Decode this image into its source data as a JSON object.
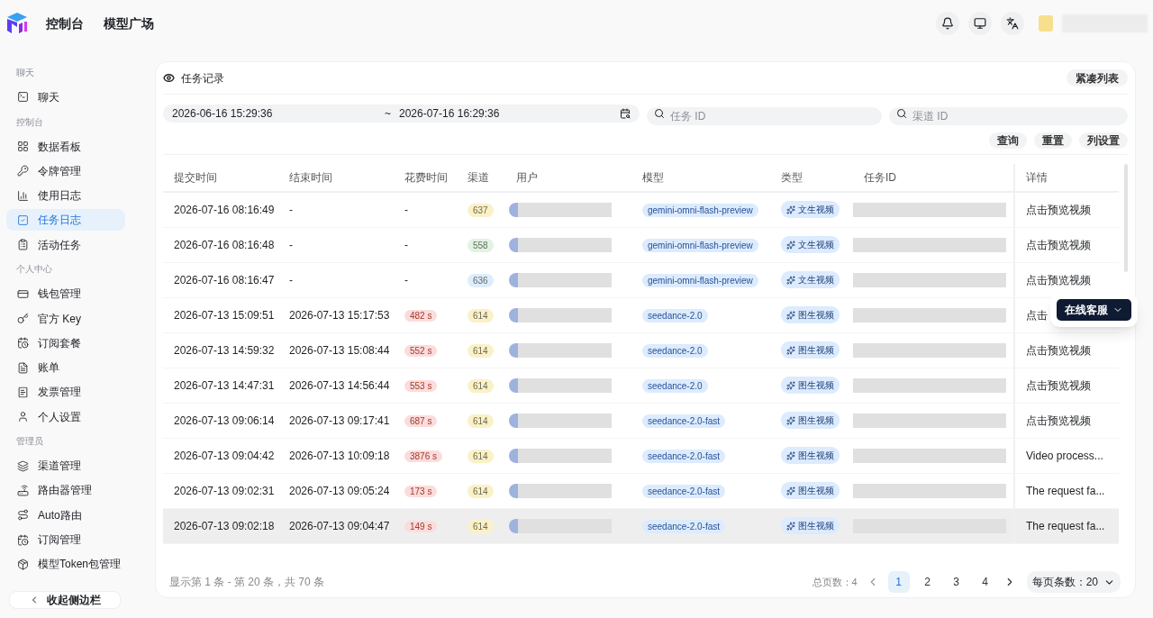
{
  "header": {
    "nav": [
      {
        "label": "控制台"
      },
      {
        "label": "模型广场"
      }
    ]
  },
  "sidebar": {
    "sections": [
      {
        "title": "聊天",
        "items": [
          {
            "label": "聊天",
            "selected": false
          }
        ]
      },
      {
        "title": "控制台",
        "items": [
          {
            "label": "数据看板",
            "selected": false
          },
          {
            "label": "令牌管理",
            "selected": false
          },
          {
            "label": "使用日志",
            "selected": false
          },
          {
            "label": "任务日志",
            "selected": true
          },
          {
            "label": "活动任务",
            "selected": false
          }
        ]
      },
      {
        "title": "个人中心",
        "items": [
          {
            "label": "钱包管理",
            "selected": false
          },
          {
            "label": "官方 Key",
            "selected": false
          },
          {
            "label": "订阅套餐",
            "selected": false
          },
          {
            "label": "账单",
            "selected": false
          },
          {
            "label": "发票管理",
            "selected": false
          },
          {
            "label": "个人设置",
            "selected": false
          }
        ]
      },
      {
        "title": "管理员",
        "items": [
          {
            "label": "渠道管理",
            "selected": false
          },
          {
            "label": "路由器管理",
            "selected": false
          },
          {
            "label": "Auto路由",
            "selected": false
          },
          {
            "label": "订阅管理",
            "selected": false
          },
          {
            "label": "模型Token包管理",
            "selected": false
          }
        ]
      }
    ],
    "collapse": "收起侧边栏"
  },
  "panel": {
    "title": "任务记录",
    "compact_button": "紧凑列表",
    "date_start": "2026-06-16 15:29:36",
    "date_separator": "~",
    "date_end": "2026-07-16 16:29:36",
    "task_id_placeholder": "任务 ID",
    "channel_id_placeholder": "渠道 ID",
    "buttons": [
      "查询",
      "重置",
      "列设置"
    ]
  },
  "table": {
    "columns": [
      "提交时间",
      "结束时间",
      "花费时间",
      "渠道",
      "用户",
      "模型",
      "类型",
      "任务ID",
      "详情"
    ],
    "rows": [
      {
        "submitted": "2026-07-16 08:16:49",
        "ended": "-",
        "duration": {
          "text": "-",
          "kind": "plain"
        },
        "channel": {
          "text": "637",
          "color": "#fbf1c7"
        },
        "model": "gemini-omni-flash-preview",
        "type": "文生视频",
        "detail": "点击预览视频",
        "hovered": false
      },
      {
        "submitted": "2026-07-16 08:16:48",
        "ended": "-",
        "duration": {
          "text": "-",
          "kind": "plain"
        },
        "channel": {
          "text": "558",
          "color": "#e1f3e4"
        },
        "model": "gemini-omni-flash-preview",
        "type": "文生视频",
        "detail": "点击预览视频",
        "hovered": false
      },
      {
        "submitted": "2026-07-16 08:16:47",
        "ended": "-",
        "duration": {
          "text": "-",
          "kind": "plain"
        },
        "channel": {
          "text": "636",
          "color": "#ddedfd"
        },
        "model": "gemini-omni-flash-preview",
        "type": "文生视频",
        "detail": "点击预览视频",
        "hovered": false
      },
      {
        "submitted": "2026-07-13 15:09:51",
        "ended": "2026-07-13 15:17:53",
        "duration": {
          "text": "482 s",
          "kind": "badge"
        },
        "channel": {
          "text": "614",
          "color": "#fbf1c7"
        },
        "model": "seedance-2.0",
        "type": "图生视频",
        "detail": "点击",
        "hovered": false
      },
      {
        "submitted": "2026-07-13 14:59:32",
        "ended": "2026-07-13 15:08:44",
        "duration": {
          "text": "552 s",
          "kind": "badge"
        },
        "channel": {
          "text": "614",
          "color": "#fbf1c7"
        },
        "model": "seedance-2.0",
        "type": "图生视频",
        "detail": "点击预览视频",
        "hovered": false
      },
      {
        "submitted": "2026-07-13 14:47:31",
        "ended": "2026-07-13 14:56:44",
        "duration": {
          "text": "553 s",
          "kind": "badge"
        },
        "channel": {
          "text": "614",
          "color": "#fbf1c7"
        },
        "model": "seedance-2.0",
        "type": "图生视频",
        "detail": "点击预览视频",
        "hovered": false
      },
      {
        "submitted": "2026-07-13 09:06:14",
        "ended": "2026-07-13 09:17:41",
        "duration": {
          "text": "687 s",
          "kind": "badge"
        },
        "channel": {
          "text": "614",
          "color": "#fbf1c7"
        },
        "model": "seedance-2.0-fast",
        "type": "图生视频",
        "detail": "点击预览视频",
        "hovered": false
      },
      {
        "submitted": "2026-07-13 09:04:42",
        "ended": "2026-07-13 10:09:18",
        "duration": {
          "text": "3876 s",
          "kind": "badge"
        },
        "channel": {
          "text": "614",
          "color": "#fbf1c7"
        },
        "model": "seedance-2.0-fast",
        "type": "图生视频",
        "detail": "Video process...",
        "hovered": false
      },
      {
        "submitted": "2026-07-13 09:02:31",
        "ended": "2026-07-13 09:05:24",
        "duration": {
          "text": "173 s",
          "kind": "badge"
        },
        "channel": {
          "text": "614",
          "color": "#fbf1c7"
        },
        "model": "seedance-2.0-fast",
        "type": "图生视频",
        "detail": "The request fa...",
        "hovered": false
      },
      {
        "submitted": "2026-07-13 09:02:18",
        "ended": "2026-07-13 09:04:47",
        "duration": {
          "text": "149 s",
          "kind": "badge"
        },
        "channel": {
          "text": "614",
          "color": "#fbf1c7"
        },
        "model": "seedance-2.0-fast",
        "type": "图生视频",
        "detail": "The request fa...",
        "hovered": true
      }
    ]
  },
  "pagination": {
    "summary": "显示第 1 条 - 第 20 条，共 70 条",
    "total_pages": "总页数：4",
    "pages": [
      {
        "label": "1",
        "selected": true
      },
      {
        "label": "2",
        "selected": false
      },
      {
        "label": "3",
        "selected": false
      },
      {
        "label": "4",
        "selected": false
      }
    ],
    "page_size": "每页条数：20"
  },
  "support_button": "在线客服"
}
